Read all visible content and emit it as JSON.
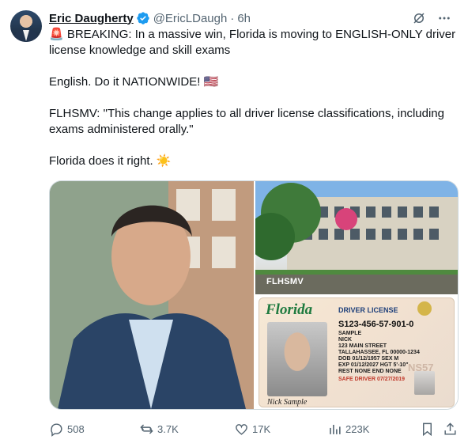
{
  "author": {
    "name": "Eric Daugherty",
    "handle": "@EricLDaugh",
    "time": "6h"
  },
  "tweet": {
    "line1": "🚨 BREAKING: In a massive win, Florida is moving to ENGLISH-ONLY driver license knowledge and skill exams",
    "line2": "English. Do it NATIONWIDE! 🇺🇸",
    "line3": "FLHSMV: \"This change applies to all driver license classifications, including exams administered orally.\"",
    "line4": "Florida does it right. ☀️"
  },
  "media": {
    "building_caption": "FLHSMV",
    "card": {
      "state": "Florida",
      "title": "DRIVER LICENSE",
      "number": "S123-456-57-901-0",
      "lines": [
        "SAMPLE",
        "NICK",
        "123 MAIN STREET",
        "TALLAHASSEE, FL 00000-1234",
        "DOB 01/12/1957   SEX M",
        "EXP 01/12/2027   HGT 5'-10\"",
        "REST NONE   END NONE"
      ],
      "safe_driver": "SAFE DRIVER 07/27/2019",
      "signature": "Nick Sample",
      "watermark": "NS57"
    }
  },
  "stats": {
    "replies": "508",
    "reposts": "3.7K",
    "likes": "17K",
    "views": "223K"
  },
  "colors": {
    "accent": "#1d9bf0",
    "muted": "#536471",
    "text": "#0f1419"
  }
}
